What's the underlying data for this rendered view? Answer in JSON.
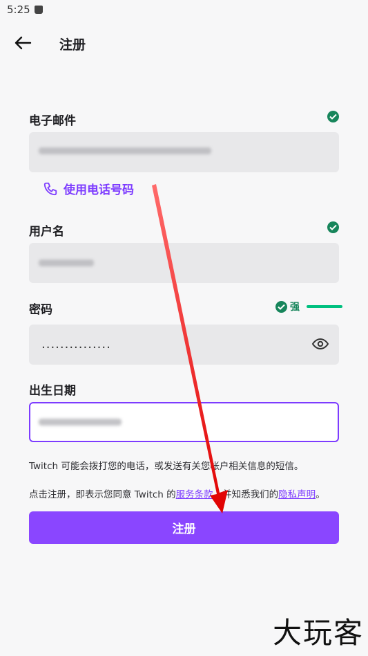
{
  "status_bar": {
    "time": "5:25"
  },
  "header": {
    "title": "注册"
  },
  "email": {
    "label": "电子邮件",
    "valid": true
  },
  "use_phone": {
    "label": "使用电话号码"
  },
  "username": {
    "label": "用户名",
    "valid": true
  },
  "password": {
    "label": "密码",
    "masked_value": "...............",
    "strength_label": "强"
  },
  "birthday": {
    "label": "出生日期"
  },
  "notices": {
    "sms": "Twitch 可能会拨打您的电话，或发送有关您帐户相关信息的短信。",
    "terms_prefix": "点击注册，即表示您同意 Twitch 的",
    "terms_link": "服务条款",
    "terms_middle": "，并知悉我们的",
    "privacy_link": "隐私声明",
    "terms_suffix": "。"
  },
  "submit": {
    "label": "注册"
  },
  "watermark": "大玩客",
  "colors": {
    "accent": "#8a46ff",
    "success": "#17855b",
    "strength_bar": "#00c07f"
  }
}
